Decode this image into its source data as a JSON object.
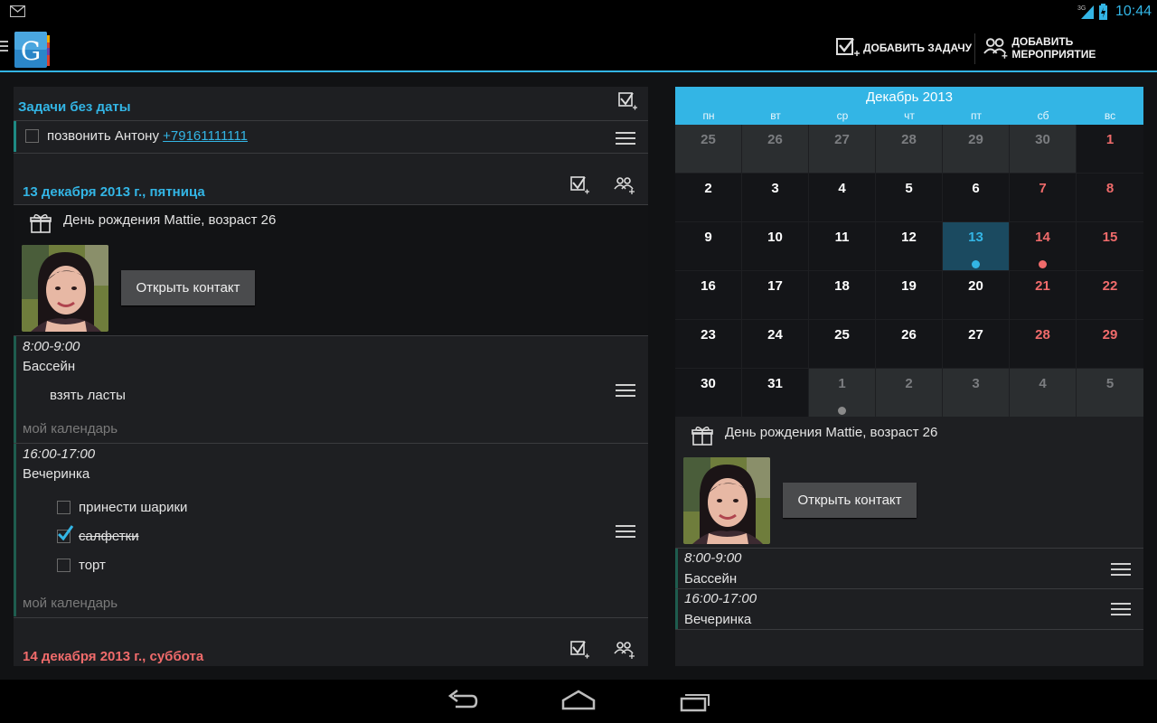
{
  "status": {
    "network": "3G",
    "time": "10:44"
  },
  "actionbar": {
    "add_task_label": "ДОБАВИТЬ ЗАДАЧУ",
    "add_event_label": "ДОБАВИТЬ МЕРОПРИЯТИЕ"
  },
  "agenda": {
    "undated_header": "Задачи без даты",
    "undated_task": {
      "text": "позвонить Антону",
      "phone": "+79161111111"
    },
    "day1": {
      "header": "13 декабря 2013 г., пятница",
      "birthday": "День рождения Mattie, возраст 26",
      "open_contact": "Открыть контакт",
      "event1": {
        "time": "8:00-9:00",
        "title": "Бассейн",
        "note": "взять ласты",
        "calendar": "мой календарь"
      },
      "event2": {
        "time": "16:00-17:00",
        "title": "Вечеринка",
        "items": [
          {
            "text": "принести шарики",
            "checked": false
          },
          {
            "text": "салфетки",
            "checked": true
          },
          {
            "text": "торт",
            "checked": false
          }
        ],
        "calendar": "мой календарь"
      }
    },
    "day2": {
      "header": "14 декабря 2013 г., суббота"
    }
  },
  "calendar": {
    "title": "Декабрь 2013",
    "weekdays": [
      "пн",
      "вт",
      "ср",
      "чт",
      "пт",
      "сб",
      "вс"
    ],
    "days": [
      "25",
      "26",
      "27",
      "28",
      "29",
      "30",
      "1",
      "2",
      "3",
      "4",
      "5",
      "6",
      "7",
      "8",
      "9",
      "10",
      "11",
      "12",
      "13",
      "14",
      "15",
      "16",
      "17",
      "18",
      "19",
      "20",
      "21",
      "22",
      "23",
      "24",
      "25",
      "26",
      "27",
      "28",
      "29",
      "30",
      "31",
      "1",
      "2",
      "3",
      "4",
      "5"
    ],
    "accent_color": "#33b5e5",
    "weekend_color": "#f06b6b"
  },
  "day_detail": {
    "birthday": "День рождения Mattie, возраст 26",
    "open_contact": "Открыть контакт",
    "events": [
      {
        "time": "8:00-9:00",
        "title": "Бассейн"
      },
      {
        "time": "16:00-17:00",
        "title": "Вечеринка"
      }
    ]
  }
}
